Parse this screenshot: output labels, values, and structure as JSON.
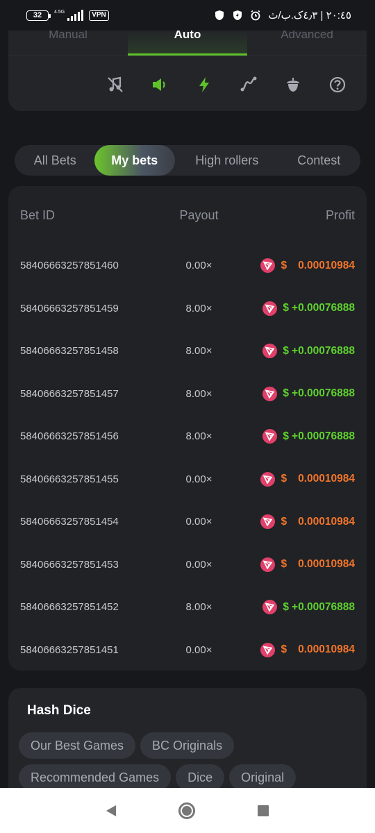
{
  "status_bar": {
    "battery": "32",
    "network": "4.5G",
    "vpn": "VPN",
    "clock": "٢٠:٤٥ | ٤٫٣ک.ب/ث"
  },
  "mode_tabs": [
    {
      "label": "Manual",
      "active": false
    },
    {
      "label": "Auto",
      "active": true
    },
    {
      "label": "Advanced",
      "active": false
    }
  ],
  "tools": [
    "music-off-icon",
    "speaker-icon",
    "lightning-icon",
    "graph-icon",
    "acorn-icon",
    "help-icon"
  ],
  "bet_tabs": [
    {
      "label": "All Bets",
      "active": false
    },
    {
      "label": "My bets",
      "active": true
    },
    {
      "label": "High rollers",
      "active": false
    },
    {
      "label": "Contest",
      "active": false
    }
  ],
  "table": {
    "headers": {
      "bet_id": "Bet ID",
      "payout": "Payout",
      "profit": "Profit"
    },
    "rows": [
      {
        "id": "58406663257851460",
        "payout": "0.00×",
        "currency": "$",
        "profit": "0.00010984",
        "win": false
      },
      {
        "id": "58406663257851459",
        "payout": "8.00×",
        "currency": "$",
        "profit": "+0.00076888",
        "win": true
      },
      {
        "id": "58406663257851458",
        "payout": "8.00×",
        "currency": "$",
        "profit": "+0.00076888",
        "win": true
      },
      {
        "id": "58406663257851457",
        "payout": "8.00×",
        "currency": "$",
        "profit": "+0.00076888",
        "win": true
      },
      {
        "id": "58406663257851456",
        "payout": "8.00×",
        "currency": "$",
        "profit": "+0.00076888",
        "win": true
      },
      {
        "id": "58406663257851455",
        "payout": "0.00×",
        "currency": "$",
        "profit": "0.00010984",
        "win": false
      },
      {
        "id": "58406663257851454",
        "payout": "0.00×",
        "currency": "$",
        "profit": "0.00010984",
        "win": false
      },
      {
        "id": "58406663257851453",
        "payout": "0.00×",
        "currency": "$",
        "profit": "0.00010984",
        "win": false
      },
      {
        "id": "58406663257851452",
        "payout": "8.00×",
        "currency": "$",
        "profit": "+0.00076888",
        "win": true
      },
      {
        "id": "58406663257851451",
        "payout": "0.00×",
        "currency": "$",
        "profit": "0.00010984",
        "win": false
      }
    ]
  },
  "hash_dice": {
    "title": "Hash Dice",
    "tags": [
      "Our Best Games",
      "BC Originals",
      "Recommended Games",
      "Dice",
      "Original"
    ]
  },
  "colors": {
    "accent": "#5fc22a",
    "loss": "#f0742a",
    "win": "#5fd02e",
    "coin": "#e0406a"
  }
}
